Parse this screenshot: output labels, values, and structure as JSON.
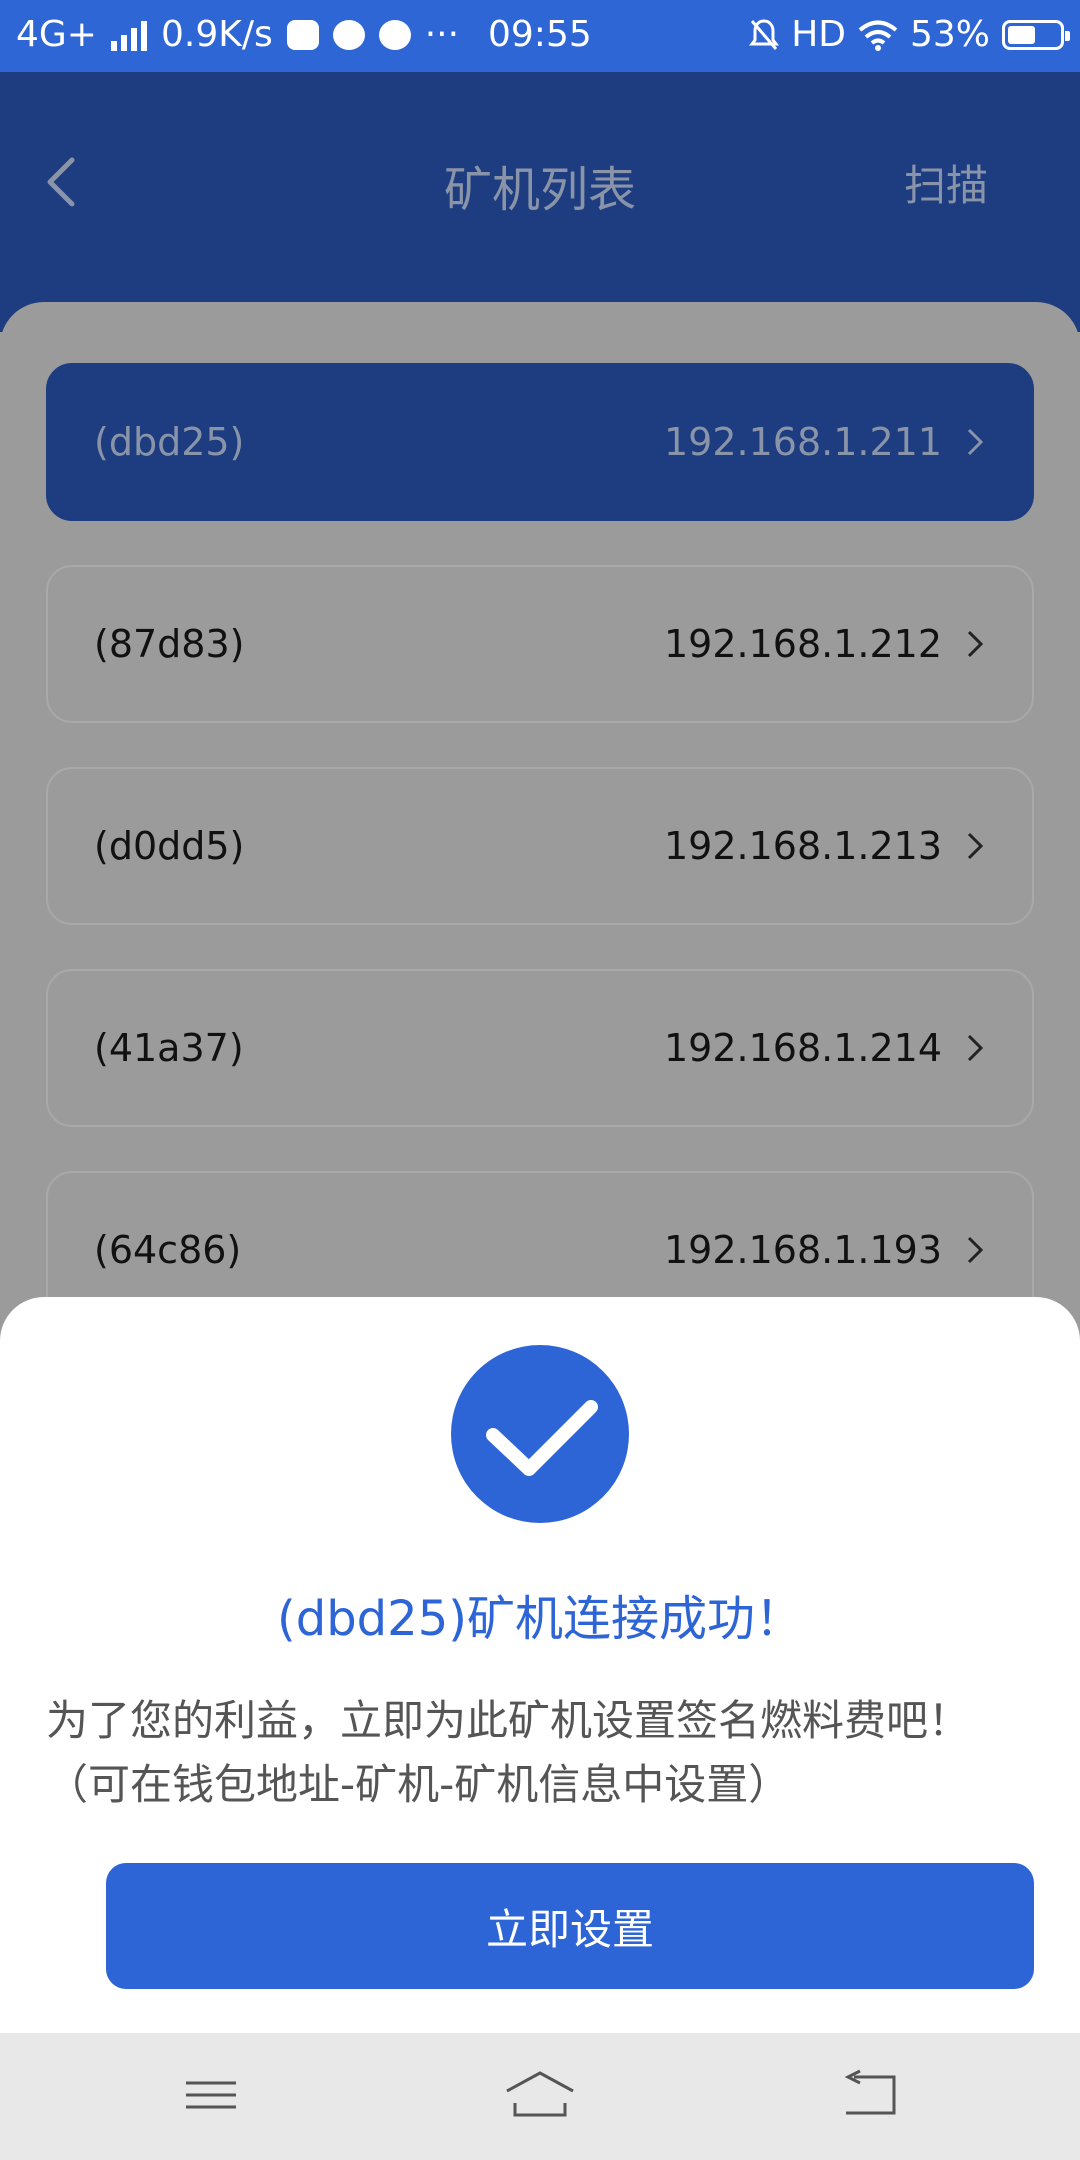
{
  "status_bar": {
    "network": "4G+",
    "speed": "0.9K/s",
    "dots": "···",
    "time": "09:55",
    "hd": "HD",
    "battery": "53%",
    "battery_level": 0.53
  },
  "header": {
    "title": "矿机列表",
    "scan_label": "扫描"
  },
  "miners": [
    {
      "name": "(dbd25)",
      "ip": "192.168.1.211"
    },
    {
      "name": "(87d83)",
      "ip": "192.168.1.212"
    },
    {
      "name": "(d0dd5)",
      "ip": "192.168.1.213"
    },
    {
      "name": "(41a37)",
      "ip": "192.168.1.214"
    },
    {
      "name": "(64c86)",
      "ip": "192.168.1.193"
    }
  ],
  "dialog": {
    "success_title": "(dbd25)矿机连接成功！",
    "message": "为了您的利益，立即为此矿机设置签名燃料费吧！（可在钱包地址-矿机-矿机信息中设置）",
    "button_label": "立即设置"
  },
  "colors": {
    "primary": "#2d64d6",
    "status_bar": "#2f66d6"
  }
}
